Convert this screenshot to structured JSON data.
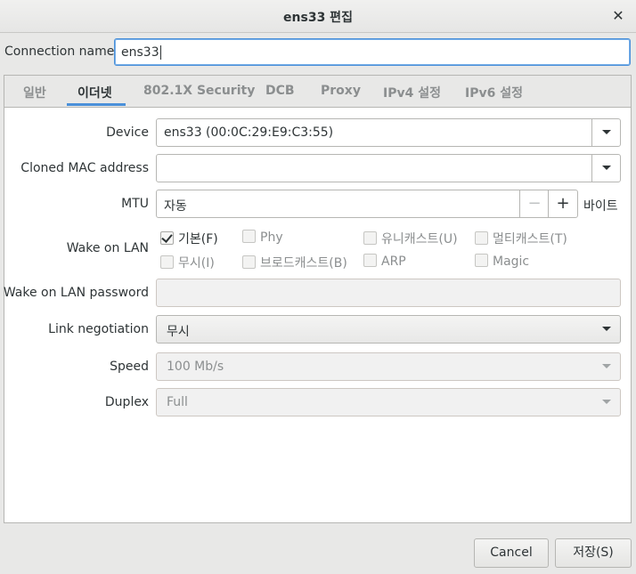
{
  "window": {
    "title": "ens33 편집",
    "close_glyph": "✕"
  },
  "connection": {
    "label": "Connection name",
    "value": "ens33"
  },
  "tabs": [
    {
      "label": "일반",
      "active": false
    },
    {
      "label": "이더넷",
      "active": true
    },
    {
      "label": "802.1X Security",
      "active": false
    },
    {
      "label": "DCB",
      "active": false
    },
    {
      "label": "Proxy",
      "active": false
    },
    {
      "label": "IPv4 설정",
      "active": false
    },
    {
      "label": "IPv6 설정",
      "active": false
    }
  ],
  "ethernet": {
    "device": {
      "label": "Device",
      "value": "ens33 (00:0C:29:E9:C3:55)"
    },
    "cloned_mac": {
      "label": "Cloned MAC address",
      "value": ""
    },
    "mtu": {
      "label": "MTU",
      "value": "자동",
      "minus": "−",
      "plus": "+",
      "unit": "바이트"
    },
    "wake_on_lan": {
      "label": "Wake on LAN",
      "options": [
        {
          "label": "기본(F)",
          "checked": true,
          "enabled": true
        },
        {
          "label": "Phy",
          "checked": false,
          "enabled": false
        },
        {
          "label": "유니캐스트(U)",
          "checked": false,
          "enabled": false
        },
        {
          "label": "멀티캐스트(T)",
          "checked": false,
          "enabled": false
        },
        {
          "label": "무시(I)",
          "checked": false,
          "enabled": false
        },
        {
          "label": "브로드캐스트(B)",
          "checked": false,
          "enabled": false
        },
        {
          "label": "ARP",
          "checked": false,
          "enabled": false
        },
        {
          "label": "Magic",
          "checked": false,
          "enabled": false
        }
      ]
    },
    "wol_password": {
      "label": "Wake on LAN password",
      "value": ""
    },
    "link_negotiation": {
      "label": "Link negotiation",
      "value": "무시"
    },
    "speed": {
      "label": "Speed",
      "value": "100 Mb/s"
    },
    "duplex": {
      "label": "Duplex",
      "value": "Full"
    }
  },
  "buttons": {
    "cancel": "Cancel",
    "save": "저장(S)"
  },
  "colors": {
    "accent": "#4a90d9",
    "background": "#e8e8e7"
  }
}
